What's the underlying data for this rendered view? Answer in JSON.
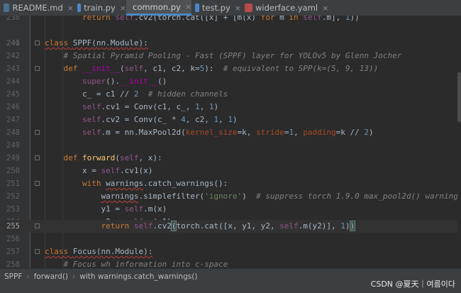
{
  "tabs": [
    {
      "label": "README.md",
      "icon": "markdown-file-icon",
      "active": false
    },
    {
      "label": "train.py",
      "icon": "python-file-icon",
      "active": false
    },
    {
      "label": "common.py",
      "icon": "python-file-icon",
      "active": true
    },
    {
      "label": "test.py",
      "icon": "python-file-icon",
      "active": false
    },
    {
      "label": "widerface.yaml",
      "icon": "yaml-file-icon",
      "active": false
    }
  ],
  "close_glyph": "×",
  "lines": {
    "l236": "236",
    "l240": "240",
    "l241": "241",
    "l242": "242",
    "l243": "243",
    "l244": "244",
    "l245": "245",
    "l246": "246",
    "l247": "247",
    "l248": "248",
    "l249": "249",
    "l250": "250",
    "l251": "251",
    "l252": "252",
    "l253": "253",
    "l254": "254",
    "l255": "255",
    "l256": "256",
    "l257": "257",
    "l258": "258"
  },
  "breadcrumbs": [
    "SPPF",
    "forward()",
    "with warnings.catch_warnings()"
  ],
  "breadcrumb_separator": "›",
  "watermark": "CSDN @夏天｜여름이다",
  "colors": {
    "keyword": "#cc7832",
    "self": "#94558d",
    "number": "#6897bb",
    "comment": "#808080",
    "string": "#6a8759"
  }
}
